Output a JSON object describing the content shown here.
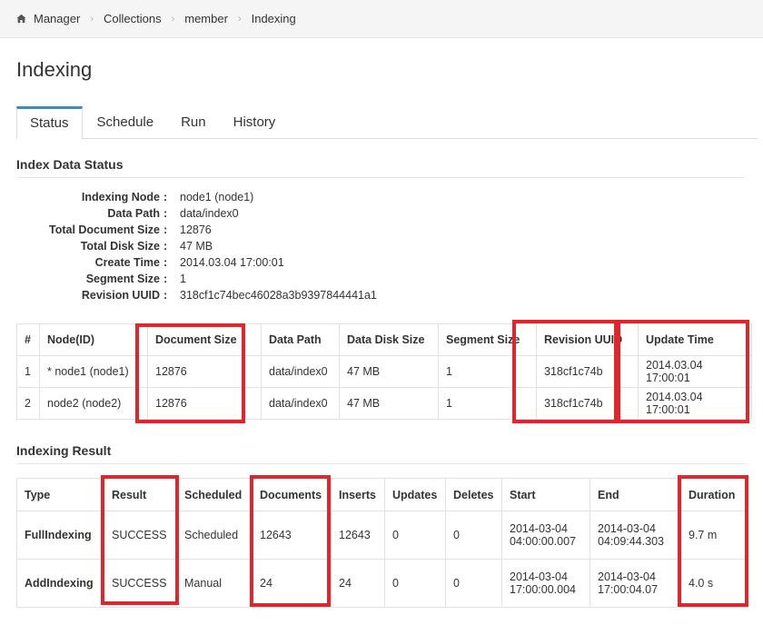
{
  "breadcrumb": {
    "items": [
      "Manager",
      "Collections",
      "member",
      "Indexing"
    ]
  },
  "page": {
    "title": "Indexing"
  },
  "tabs": [
    "Status",
    "Schedule",
    "Run",
    "History"
  ],
  "index_data_status": {
    "heading": "Index Data Status",
    "fields": [
      {
        "label": "Indexing Node",
        "value": "node1 (node1)"
      },
      {
        "label": "Data Path",
        "value": "data/index0"
      },
      {
        "label": "Total Document Size",
        "value": "12876"
      },
      {
        "label": "Total Disk Size",
        "value": "47 MB"
      },
      {
        "label": "Create Time",
        "value": "2014.03.04 17:00:01"
      },
      {
        "label": "Segment Size",
        "value": "1"
      },
      {
        "label": "Revision UUID",
        "value": "318cf1c74bec46028a3b9397844441a1"
      }
    ]
  },
  "nodes_table": {
    "headers": [
      "#",
      "Node(ID)",
      "Document Size",
      "Data Path",
      "Data Disk Size",
      "Segment Size",
      "Revision UUID",
      "Update Time"
    ],
    "rows": [
      [
        "1",
        "* node1 (node1)",
        "12876",
        "data/index0",
        "47 MB",
        "1",
        "318cf1c74b",
        "2014.03.04 17:00:01"
      ],
      [
        "2",
        "node2 (node2)",
        "12876",
        "data/index0",
        "47 MB",
        "1",
        "318cf1c74b",
        "2014.03.04 17:00:01"
      ]
    ]
  },
  "indexing_result": {
    "heading": "Indexing Result",
    "headers": [
      "Type",
      "Result",
      "Scheduled",
      "Documents",
      "Inserts",
      "Updates",
      "Deletes",
      "Start",
      "End",
      "Duration"
    ],
    "rows": [
      {
        "type": "FullIndexing",
        "result": "SUCCESS",
        "scheduled": "Scheduled",
        "documents": "12643",
        "inserts": "12643",
        "updates": "0",
        "deletes": "0",
        "start_date": "2014-03-04",
        "start_time": "04:00:00.007",
        "end_date": "2014-03-04",
        "end_time": "04:09:44.303",
        "duration": "9.7 m"
      },
      {
        "type": "AddIndexing",
        "result": "SUCCESS",
        "scheduled": "Manual",
        "documents": "24",
        "inserts": "24",
        "updates": "0",
        "deletes": "0",
        "start_date": "2014-03-04",
        "start_time": "17:00:00.004",
        "end_date": "2014-03-04",
        "end_time": "17:00:04.07",
        "duration": "4.0 s"
      }
    ]
  },
  "colors": {
    "highlight": "#e0262a",
    "active_tab": "#3c8dbc"
  }
}
